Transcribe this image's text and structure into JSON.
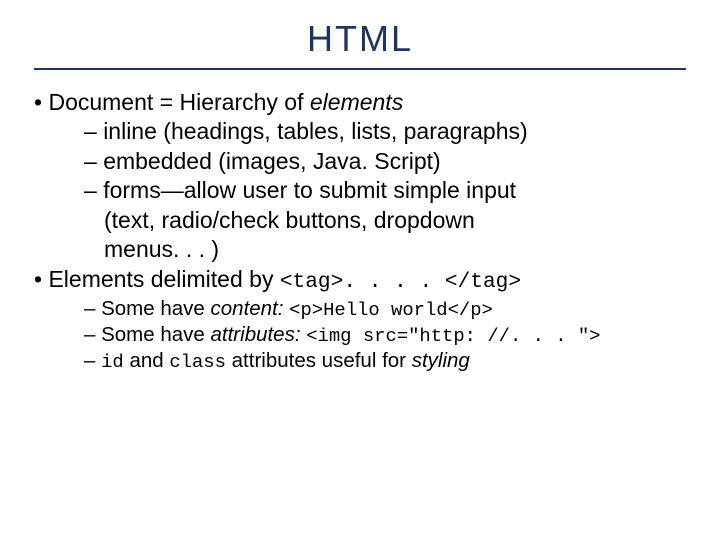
{
  "title": "HTML",
  "b1a_pre": "Document = Hierarchy of ",
  "b1a_em": "elements",
  "b2a": "inline (headings, tables, lists, paragraphs)",
  "b2b": "embedded (images, Java. Script)",
  "b2c_l1": "forms—allow user to submit simple input",
  "b2c_l2": "(text, radio/check buttons, dropdown",
  "b2c_l3": "menus. . . )",
  "b1b_pre": "Elements delimited by ",
  "b1b_code": "<tag>. . . . </tag>",
  "b2d_pre": "Some have ",
  "b2d_em": "content: ",
  "b2d_code": "<p>Hello world</p>",
  "b2e_pre": "Some have ",
  "b2e_em": "attributes: ",
  "b2e_code": "<img src=\"http: //. . . \">",
  "b2f_c1": "id",
  "b2f_t1": " and ",
  "b2f_c2": "class",
  "b2f_t2": " attributes useful for ",
  "b2f_em": "styling"
}
